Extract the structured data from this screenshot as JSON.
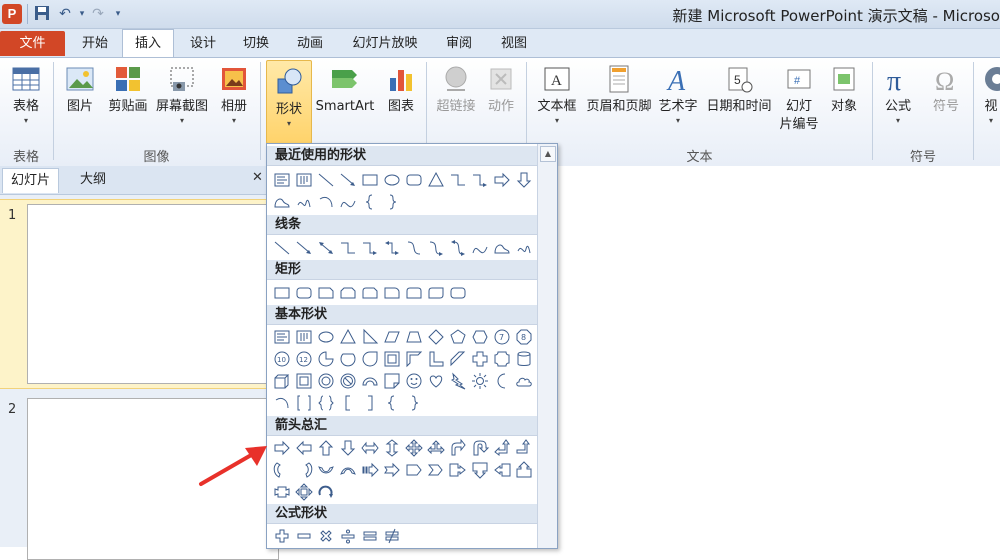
{
  "window": {
    "app_icon_letter": "P",
    "title": "新建 Microsoft PowerPoint 演示文稿 - Microso",
    "quick_access": [
      "save-icon",
      "undo-icon",
      "redo-icon",
      "customize-icon"
    ]
  },
  "tabs": [
    "文件",
    "开始",
    "插入",
    "设计",
    "切换",
    "动画",
    "幻灯片放映",
    "审阅",
    "视图"
  ],
  "active_tab": "插入",
  "ribbon": {
    "groups": [
      {
        "label": "表格",
        "buttons": [
          {
            "label": "表格",
            "icon": "table-icon"
          }
        ]
      },
      {
        "label": "图像",
        "buttons": [
          {
            "label": "图片",
            "icon": "picture-icon"
          },
          {
            "label": "剪贴画",
            "icon": "clipart-icon"
          },
          {
            "label": "屏幕截图",
            "icon": "screenshot-icon"
          },
          {
            "label": "相册",
            "icon": "photo-album-icon"
          }
        ]
      },
      {
        "label": "",
        "buttons": [
          {
            "label": "形状",
            "icon": "shapes-icon"
          },
          {
            "label": "SmartArt",
            "icon": "smartart-icon"
          },
          {
            "label": "图表",
            "icon": "chart-icon"
          }
        ]
      },
      {
        "label": "",
        "buttons": [
          {
            "label": "超链接",
            "icon": "hyperlink-icon",
            "disabled": true
          },
          {
            "label": "动作",
            "icon": "action-icon",
            "disabled": true
          }
        ]
      },
      {
        "label": "文本",
        "buttons": [
          {
            "label": "文本框",
            "icon": "textbox-icon"
          },
          {
            "label": "页眉和页脚",
            "icon": "header-footer-icon"
          },
          {
            "label": "艺术字",
            "icon": "wordart-icon"
          },
          {
            "label": "日期和时间",
            "icon": "date-time-icon"
          },
          {
            "label": "幻灯片编号",
            "icon": "slide-number-icon",
            "label_lines": [
              "幻灯",
              "片编号"
            ]
          },
          {
            "label": "对象",
            "icon": "object-icon"
          }
        ]
      },
      {
        "label": "符号",
        "buttons": [
          {
            "label": "公式",
            "icon": "equation-icon"
          },
          {
            "label": "符号",
            "icon": "symbol-icon",
            "disabled": true
          }
        ]
      },
      {
        "label": "",
        "buttons": [
          {
            "label": "视",
            "icon": "video-icon"
          }
        ]
      }
    ]
  },
  "left_pane": {
    "tabs": [
      "幻灯片",
      "大纲"
    ],
    "active_tab": "幻灯片",
    "close_glyph": "✕",
    "slides": [
      "1",
      "2"
    ]
  },
  "shapes_gallery": {
    "sections": [
      {
        "title": "最近使用的形状",
        "rows": 2
      },
      {
        "title": "线条",
        "rows": 1
      },
      {
        "title": "矩形",
        "rows": 1
      },
      {
        "title": "基本形状",
        "rows": 4
      },
      {
        "title": "箭头总汇",
        "rows": 3
      },
      {
        "title": "公式形状",
        "rows": 1
      }
    ]
  },
  "colors": {
    "file_tab": "#d24726",
    "ribbon_bg": "#e8eef7",
    "active_button": "#ffd36b",
    "annotation_arrow": "#e8312a"
  }
}
